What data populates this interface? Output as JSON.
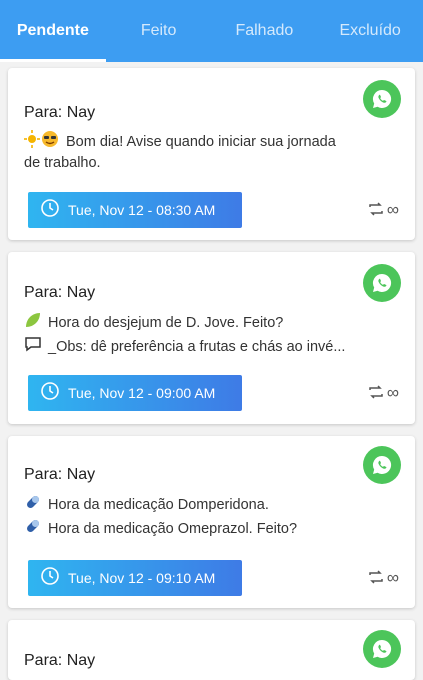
{
  "tabs": [
    {
      "label": "Pendente",
      "active": true
    },
    {
      "label": "Feito",
      "active": false
    },
    {
      "label": "Falhado",
      "active": false
    },
    {
      "label": "Excluído",
      "active": false
    }
  ],
  "colors": {
    "tabbar": "#3d9df2",
    "whatsapp": "#4cc55a",
    "date_button_start": "#2fb5f0",
    "date_button_end": "#3e7be6"
  },
  "cards": [
    {
      "recipient": "Para: Nay",
      "lines": [
        {
          "icon": "sun-emoji",
          "text": "Bom dia! Avise quando iniciar sua jornada"
        },
        {
          "icon": "",
          "text": "de trabalho."
        }
      ],
      "datetime": "Tue, Nov 12 - 08:30 AM",
      "repeat": "∞"
    },
    {
      "recipient": "Para: Nay",
      "lines": [
        {
          "icon": "leaf-icon",
          "text": "Hora do desjejum de D. Jove. Feito?"
        },
        {
          "icon": "speech-bubble-icon",
          "text": "_Obs: dê preferência a frutas e chás ao invé..."
        }
      ],
      "datetime": "Tue, Nov 12 - 09:00 AM",
      "repeat": "∞"
    },
    {
      "recipient": "Para: Nay",
      "lines": [
        {
          "icon": "pill-icon",
          "text": "Hora da medicação Domperidona."
        },
        {
          "icon": "pill-icon",
          "text": "Hora da medicação Omeprazol. Feito?"
        }
      ],
      "datetime": "Tue, Nov 12 - 09:10 AM",
      "repeat": "∞"
    },
    {
      "recipient": "Para: Nay"
    }
  ]
}
